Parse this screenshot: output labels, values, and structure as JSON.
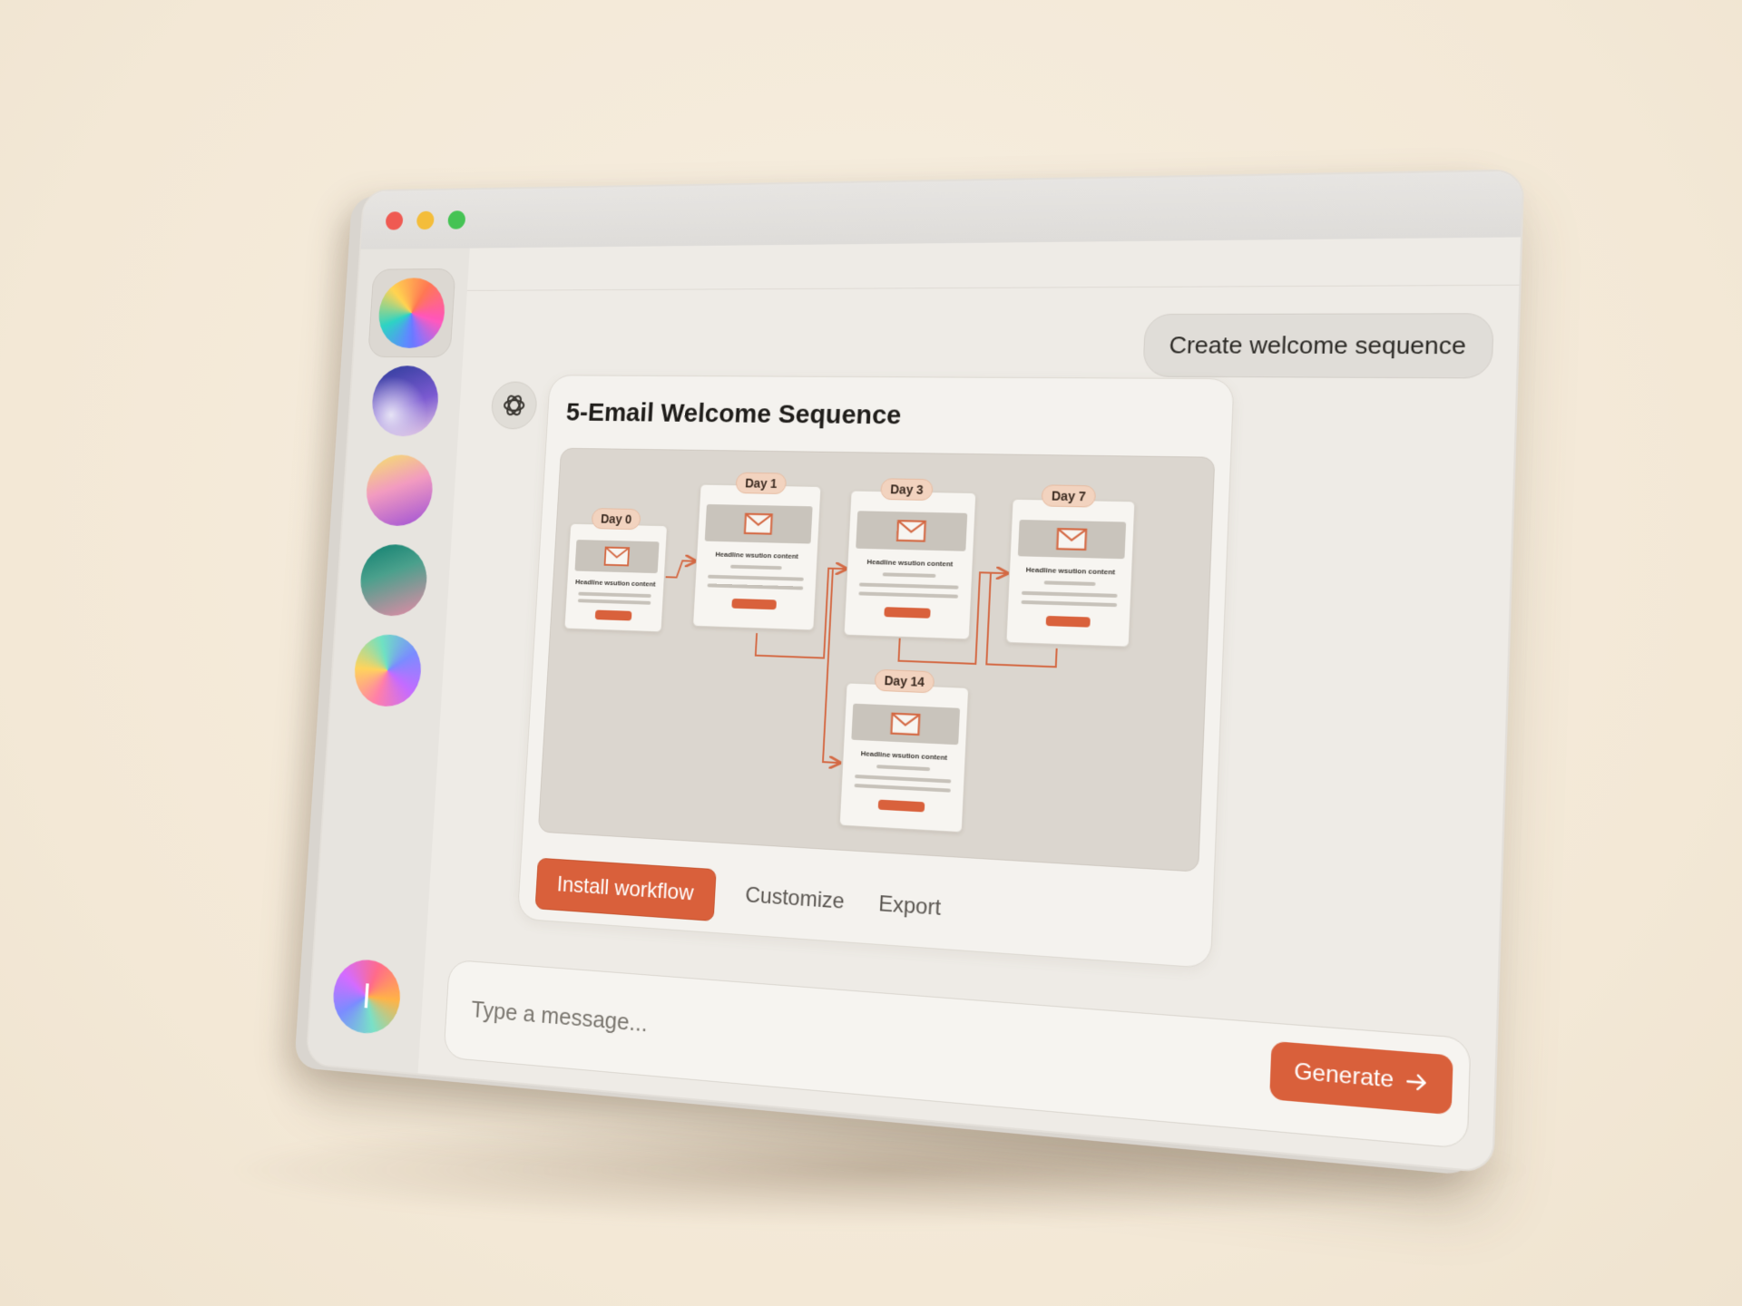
{
  "window": {
    "traffic_lights": [
      "close",
      "minimize",
      "zoom"
    ]
  },
  "sidebar": {
    "items": [
      {
        "name": "assistant-orb-1",
        "selected": true
      },
      {
        "name": "assistant-orb-2",
        "selected": false
      },
      {
        "name": "assistant-orb-3",
        "selected": false
      },
      {
        "name": "assistant-orb-4",
        "selected": false
      },
      {
        "name": "assistant-orb-5",
        "selected": false
      }
    ],
    "user_avatar_initial": "I"
  },
  "chat": {
    "user_message": "Create welcome sequence",
    "assistant_icon": "openai-logo-icon",
    "card": {
      "title": "5-Email Welcome Sequence",
      "emails": [
        {
          "day": "Day 0",
          "headline": "Headline wsution content"
        },
        {
          "day": "Day 1",
          "headline": "Headline wsution content"
        },
        {
          "day": "Day 3",
          "headline": "Headline wsution content"
        },
        {
          "day": "Day 7",
          "headline": "Headline wsution content"
        },
        {
          "day": "Day 14",
          "headline": "Headline wsution content"
        }
      ],
      "actions": {
        "install": "Install workflow",
        "customize": "Customize",
        "export": "Export"
      }
    }
  },
  "composer": {
    "placeholder": "Type a message...",
    "generate_label": "Generate",
    "generate_icon": "arrow-right-icon"
  },
  "colors": {
    "accent": "#d9603b",
    "background": "#f5ecdc",
    "window": "#efece7",
    "day_pill": "#f2d3bf"
  }
}
